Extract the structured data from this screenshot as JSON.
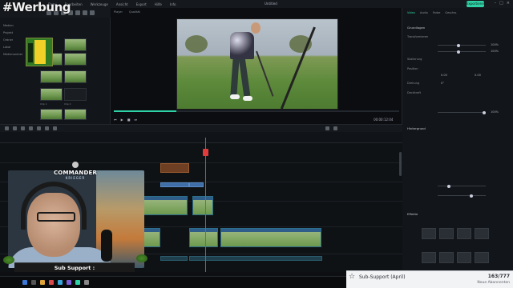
{
  "overlay": {
    "werbung": "#Werbung"
  },
  "menubar": {
    "items": [
      "Datei",
      "Bearbeiten",
      "Werkzeuge",
      "Ansicht",
      "Export",
      "Hilfe",
      "Info"
    ],
    "window_title": "Untitled",
    "export_label": "Exportieren"
  },
  "left_panel": {
    "nav": [
      "Medien",
      "Projekt",
      "Ordner",
      "Lokal",
      "Medienordner"
    ],
    "thumb_labels": [
      "Clip 1",
      "Clip 2",
      "Clip 3"
    ]
  },
  "preview": {
    "tabs": [
      "Player",
      "Qualität"
    ],
    "timecode": "00:00:12:04",
    "progress_fraction": 0.22
  },
  "right_panel": {
    "tabs": [
      "Video",
      "Audio",
      "Farbe",
      "Geschw."
    ],
    "sections": [
      "Grundlagen",
      "Transformieren",
      "Skalierung",
      "Position",
      "Drehung",
      "Deckkraft",
      "Hintergrund",
      "Effekte"
    ],
    "values": [
      "100%",
      "100%",
      "0.00",
      "0.00",
      "0°",
      "100%"
    ]
  },
  "webcam": {
    "name_line1": "COMMANDER",
    "name_line2": "KRIEGER",
    "sub_support": "Sub Support :"
  },
  "widget": {
    "label": "Sub-Support (April)",
    "count": "163/777",
    "sub_label": "Neue Abonnenten"
  },
  "colors": {
    "accent": "#2fd2a6",
    "playhead": "#e23b3b",
    "clip_border": "#2b6f8a",
    "logo_green": "#2f7a23",
    "logo_yellow": "#f1d127"
  },
  "icons": [
    "star-icon",
    "playhead-icon",
    "play-icon",
    "logo-icon"
  ]
}
